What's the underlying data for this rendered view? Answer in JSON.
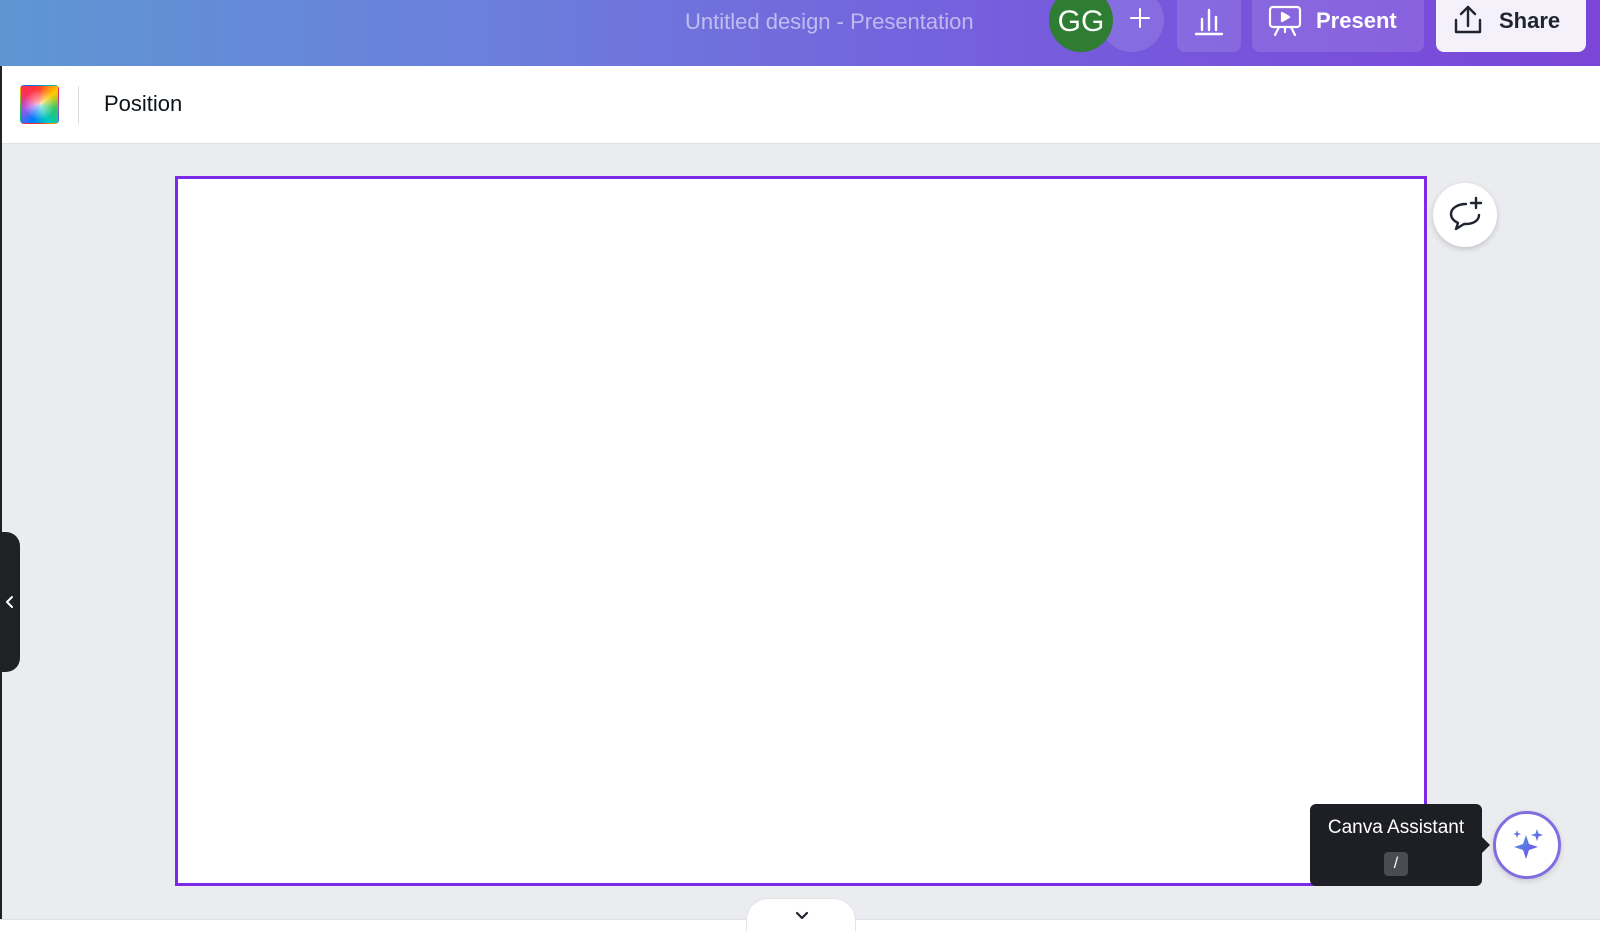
{
  "header": {
    "document_title": "Untitled design - Presentation",
    "avatar_initials": "GG",
    "present_label": "Present",
    "share_label": "Share"
  },
  "toolbar": {
    "position_label": "Position"
  },
  "assistant": {
    "tooltip_title": "Canva Assistant",
    "shortcut_key": "/"
  },
  "colors": {
    "header_gradient_start": "#5e96d2",
    "header_gradient_end": "#7a45d8",
    "selection_border": "#7d2ae8",
    "canvas_background": "#ebecf0",
    "avatar_background": "#2e7d32"
  },
  "icons": {
    "add_collaborator": "plus-icon",
    "insights": "bar-chart-icon",
    "present": "presentation-screen-icon",
    "share": "upload-icon",
    "add_comment": "comment-plus-icon",
    "assistant": "sparkle-icon",
    "side_panel": "chevron-left-icon",
    "pages": "chevron-down-icon"
  }
}
